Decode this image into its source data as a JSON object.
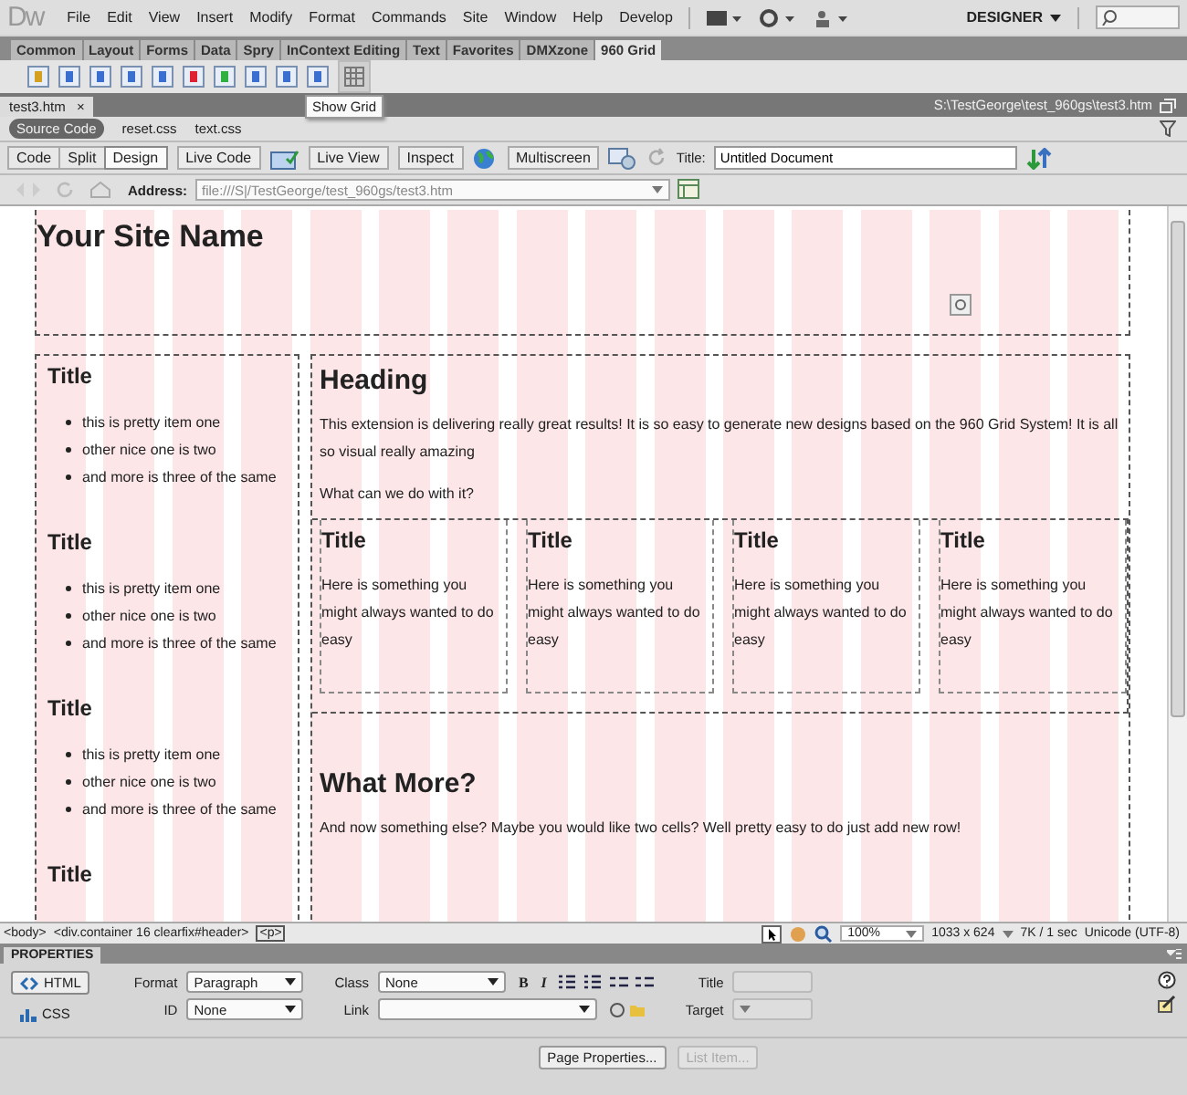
{
  "app": {
    "logo": "Dw",
    "menu": [
      "File",
      "Edit",
      "View",
      "Insert",
      "Modify",
      "Format",
      "Commands",
      "Site",
      "Window",
      "Help",
      "Develop"
    ],
    "workspace": "DESIGNER"
  },
  "insert_tabs": [
    {
      "label": "Common",
      "selected": false
    },
    {
      "label": "Layout",
      "selected": false
    },
    {
      "label": "Forms",
      "selected": false
    },
    {
      "label": "Data",
      "selected": false
    },
    {
      "label": "Spry",
      "selected": false
    },
    {
      "label": "InContext Editing",
      "selected": false
    },
    {
      "label": "Text",
      "selected": false
    },
    {
      "label": "Favorites",
      "selected": false
    },
    {
      "label": "DMXzone",
      "selected": false
    },
    {
      "label": "960 Grid",
      "selected": true
    }
  ],
  "tooltip": "Show Grid",
  "doc_tabs": [
    {
      "label": "test3.htm",
      "selected": true
    }
  ],
  "doc_close": "×",
  "file_path": "S:\\TestGeorge\\test_960gs\\test3.htm",
  "related_files": [
    {
      "label": "Source Code",
      "selected": true
    },
    {
      "label": "reset.css",
      "selected": false
    },
    {
      "label": "text.css",
      "selected": false
    }
  ],
  "view_buttons": [
    {
      "label": "Code",
      "selected": false
    },
    {
      "label": "Split",
      "selected": false
    },
    {
      "label": "Design",
      "selected": true
    }
  ],
  "doc_buttons": {
    "live_code": "Live Code",
    "live_view": "Live View",
    "inspect": "Inspect",
    "multiscreen": "Multiscreen"
  },
  "title_label": "Title:",
  "title_value": "Untitled Document",
  "address_label": "Address:",
  "address_value": "file:///S|/TestGeorge/test_960gs/test3.htm",
  "page": {
    "site_name": "Your Site Name",
    "sidebar": [
      {
        "title": "Title",
        "items": [
          "this is pretty item one",
          "other nice one is two",
          "and more is three of the same"
        ]
      },
      {
        "title": "Title",
        "items": [
          "this is pretty item one",
          "other nice one is two",
          "and more is three of the same"
        ]
      },
      {
        "title": "Title",
        "items": [
          "this is pretty item one",
          "other nice one is two",
          "and more is three of the same"
        ]
      },
      {
        "title": "Title"
      }
    ],
    "heading": "Heading",
    "paragraph": "This extension is delivering really great results! It is so easy to generate new designs based on the 960 Grid System! It is all so visual really amazing",
    "question": "What can we do with it?",
    "cards": [
      {
        "title": "Title",
        "text": "Here is something you might always wanted to do easy"
      },
      {
        "title": "Title",
        "text": "Here is something you might always wanted to do easy"
      },
      {
        "title": "Title",
        "text": "Here is something you might always wanted to do easy"
      },
      {
        "title": "Title",
        "text": "Here is something you might always wanted to do easy"
      }
    ],
    "heading2": "What More?",
    "paragraph2": "And now something else? Maybe you would like two cells? Well pretty easy to do just add new row!"
  },
  "status": {
    "tags": [
      {
        "label": "<body>",
        "selected": false
      },
      {
        "label": "<div.container 16 clearfix#header>",
        "selected": false
      },
      {
        "label": "<p>",
        "selected": true
      }
    ],
    "zoom": "100%",
    "size": "1033 x 624",
    "speed": "7K / 1 sec",
    "encoding": "Unicode (UTF-8)"
  },
  "properties": {
    "title": "PROPERTIES",
    "modes": [
      {
        "label": "HTML",
        "selected": true
      },
      {
        "label": "CSS",
        "selected": false
      }
    ],
    "format_label": "Format",
    "format": "Paragraph",
    "id_label": "ID",
    "id": "None",
    "class_label": "Class",
    "class": "None",
    "link_label": "Link",
    "title_label": "Title",
    "target_label": "Target",
    "bold": "B",
    "italic": "I",
    "buttons": [
      {
        "label": "Page Properties...",
        "disabled": false
      },
      {
        "label": "List Item...",
        "disabled": true
      }
    ]
  }
}
